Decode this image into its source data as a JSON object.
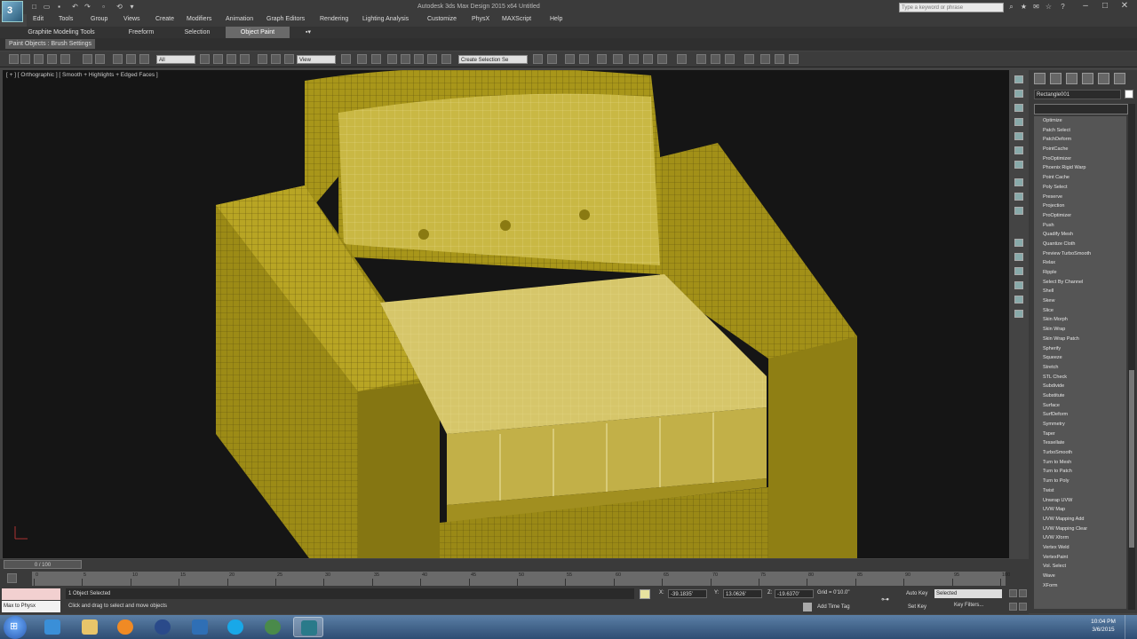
{
  "window": {
    "title": "Autodesk 3ds Max Design 2015 x64    Untitled",
    "search_placeholder": "Type a keyword or phrase"
  },
  "menu": [
    "Edit",
    "Tools",
    "Group",
    "Views",
    "Create",
    "Modifiers",
    "Animation",
    "Graph Editors",
    "Rendering",
    "Lighting Analysis",
    "Customize",
    "PhysX",
    "MAXScript",
    "Help"
  ],
  "ribbon": {
    "tabs": [
      "Graphite Modeling Tools",
      "Freeform",
      "Selection",
      "Object Paint"
    ],
    "active_tab": "Object Paint",
    "panel_label": "Paint Objects : Brush Settings"
  },
  "toolbar": {
    "selection_filter": "All",
    "reference_coord": "View",
    "named_selection": "Create Selection Se"
  },
  "viewport": {
    "label": "[ + ] [ Orthographic ] [ Smooth + Highlights + Edged Faces ]",
    "mesh_color": "#b8a21e",
    "background": "#151515"
  },
  "command_panel": {
    "object_name": "Rectangle001",
    "modifiers": [
      "Optimize",
      "Patch Select",
      "PatchDeform",
      "PointCache",
      "ProOptimizer",
      "Phoenix Rigid Warp",
      "Point Cache",
      "Poly Select",
      "Preserve",
      "Projection",
      "ProOptimizer",
      "Push",
      "Quadify Mesh",
      "Quantize Cloth",
      "Preview TurboSmooth",
      "Relax",
      "Ripple",
      "Select By Channel",
      "Shell",
      "Skew",
      "Slice",
      "Skin Morph",
      "Skin Wrap",
      "Skin Wrap Patch",
      "Spherify",
      "Squeeze",
      "Stretch",
      "STL Check",
      "Subdivide",
      "Substitute",
      "Surface",
      "SurfDeform",
      "Symmetry",
      "Taper",
      "Tessellate",
      "TurboSmooth",
      "Turn to Mesh",
      "Turn to Patch",
      "Turn to Poly",
      "Twist",
      "Unwrap UVW",
      "UVW Map",
      "UVW Mapping Add",
      "UVW Mapping Clear",
      "UVW Xform",
      "Vertex Weld",
      "VertexPaint",
      "Vol. Select",
      "Wave",
      "XForm"
    ]
  },
  "timeline": {
    "slider": "0 / 100",
    "ticks": [
      "0",
      "5",
      "10",
      "15",
      "20",
      "25",
      "30",
      "35",
      "40",
      "45",
      "50",
      "55",
      "60",
      "65",
      "70",
      "75",
      "80",
      "85",
      "90",
      "95",
      "100"
    ]
  },
  "status": {
    "welcome": "Max to Physx",
    "selection": "1 Object Selected",
    "prompt": "Click and drag to select and move objects",
    "x_label": "X:",
    "x": "-39.1835'",
    "y_label": "Y:",
    "y": "13.0626'",
    "z_label": "Z:",
    "z": "-19.6370'",
    "grid": "Grid = 0'10.0\"",
    "add_time_tag": "Add Time Tag",
    "auto_key": "Auto Key",
    "set_key": "Set Key",
    "key_mode": "Selected",
    "key_filters": "Key Filters..."
  },
  "taskbar": {
    "time": "10:04 PM",
    "date": "3/6/2015"
  }
}
